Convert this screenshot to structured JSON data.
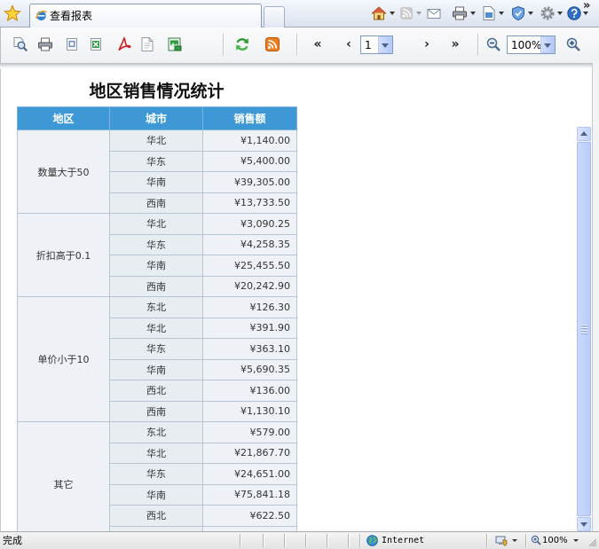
{
  "browser": {
    "tab_title": "查看报表",
    "favorites_icon": "favorites-star-icon",
    "tab_icon": "ie-page-icon",
    "command_icons": [
      "home-icon",
      "feeds-icon",
      "read-mail-icon",
      "print-icon",
      "page-icon",
      "safety-icon",
      "tools-icon",
      "help-icon"
    ],
    "more_label": "»"
  },
  "toolbar": {
    "export_icons": [
      "find-icon",
      "print-icon",
      "export-html-icon",
      "export-excel-icon",
      "export-pdf-icon",
      "export-text-icon",
      "export-image-icon"
    ],
    "refresh_icon": "refresh-icon",
    "feed_icon": "rss-icon",
    "first_label": "«",
    "prev_label": "‹",
    "page_value": "1",
    "next_label": "›",
    "last_label": "»",
    "zoom_out_icon": "zoom-out-icon",
    "zoom_value": "100%",
    "zoom_in_icon": "zoom-in-icon"
  },
  "report": {
    "title": "地区销售情况统计",
    "columns": {
      "region": "地区",
      "city": "城市",
      "sales": "销售额"
    },
    "groups": [
      {
        "region": "数量大于50",
        "rows": [
          {
            "city": "华北",
            "sales": "¥1,140.00"
          },
          {
            "city": "华东",
            "sales": "¥5,400.00"
          },
          {
            "city": "华南",
            "sales": "¥39,305.00"
          },
          {
            "city": "西南",
            "sales": "¥13,733.50"
          }
        ]
      },
      {
        "region": "折扣高于0.1",
        "rows": [
          {
            "city": "华北",
            "sales": "¥3,090.25"
          },
          {
            "city": "华东",
            "sales": "¥4,258.35"
          },
          {
            "city": "华南",
            "sales": "¥25,455.50"
          },
          {
            "city": "西南",
            "sales": "¥20,242.90"
          }
        ]
      },
      {
        "region": "单价小于10",
        "rows": [
          {
            "city": "东北",
            "sales": "¥126.30"
          },
          {
            "city": "华北",
            "sales": "¥391.90"
          },
          {
            "city": "华东",
            "sales": "¥363.10"
          },
          {
            "city": "华南",
            "sales": "¥5,690.35"
          },
          {
            "city": "西北",
            "sales": "¥136.00"
          },
          {
            "city": "西南",
            "sales": "¥1,130.10"
          }
        ]
      },
      {
        "region": "其它",
        "rows": [
          {
            "city": "东北",
            "sales": "¥579.00"
          },
          {
            "city": "华北",
            "sales": "¥21,867.70"
          },
          {
            "city": "华东",
            "sales": "¥24,651.00"
          },
          {
            "city": "华南",
            "sales": "¥75,841.18"
          },
          {
            "city": "西北",
            "sales": "¥622.50"
          },
          {
            "city": "",
            "sales": ""
          }
        ]
      }
    ]
  },
  "status": {
    "text": "完成",
    "zone": "Internet",
    "zoom": "100%"
  },
  "colors": {
    "header_bg": "#3f98d6",
    "cell_bg": "#eef2f6",
    "cell_border": "#b7c4d2",
    "scroll_thumb": "#c3d3fa"
  }
}
